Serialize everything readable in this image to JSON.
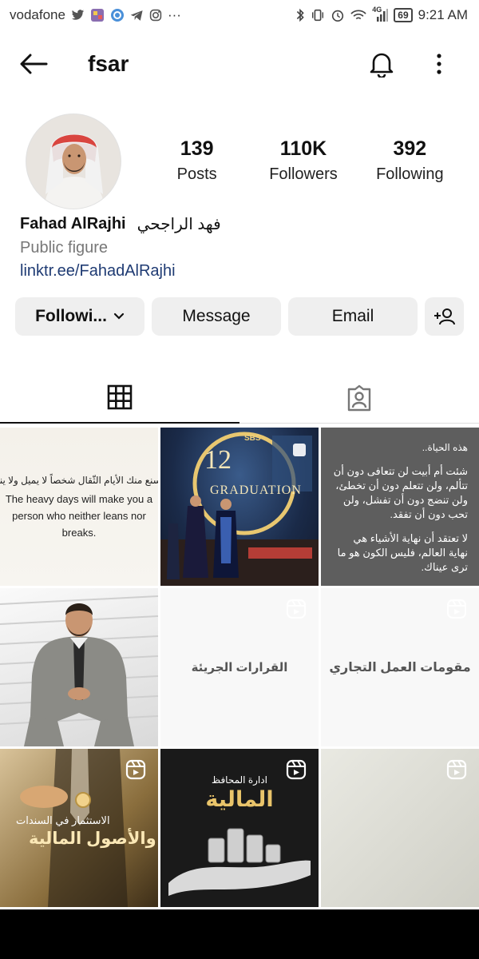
{
  "status_bar": {
    "carrier": "vodafone",
    "network": "4G",
    "battery": "69",
    "time": "9:21 AM"
  },
  "header": {
    "username": "fsar"
  },
  "profile": {
    "stats": [
      {
        "value": "139",
        "label": "Posts"
      },
      {
        "value": "110K",
        "label": "Followers"
      },
      {
        "value": "392",
        "label": "Following"
      }
    ],
    "name": "Fahad AlRajhi",
    "name_ar": "فهد الراجحي",
    "category": "Public figure",
    "link": "linktr.ee/FahadAlRajhi"
  },
  "buttons": {
    "following": "Followi...",
    "message": "Message",
    "email": "Email"
  },
  "posts": {
    "p1": {
      "ar": "سنع منك الأيام الثّقال شخصاً لا يميل ولا ينـ",
      "en": "The heavy days will make you a person who neither leans nor breaks."
    },
    "p2": {
      "badge": "SBS",
      "number": "12",
      "word": "GRADUATION"
    },
    "p3": {
      "title": "هذه الحياة..",
      "body1": "شئت أم أبيت لن تتعافى دون أن تتألم، ولن تتعلم دون أن تخطئ، ولن تنضج دون أن تفشل، ولن تحب دون أن تفقد.",
      "body2": "لا تعتقد أن نهاية الأشياء هي نهاية العالم، فليس الكون هو ما ترى عيناك."
    },
    "p5": {
      "text": "القرارات الجريئة"
    },
    "p6": {
      "text": "مقومات العمل التجاري"
    },
    "p7": {
      "line1": "الاستثمار في السندات",
      "line2": "والأصول المالية"
    },
    "p8": {
      "line1": "ادارة المحافظ",
      "line2": "المالية"
    }
  }
}
